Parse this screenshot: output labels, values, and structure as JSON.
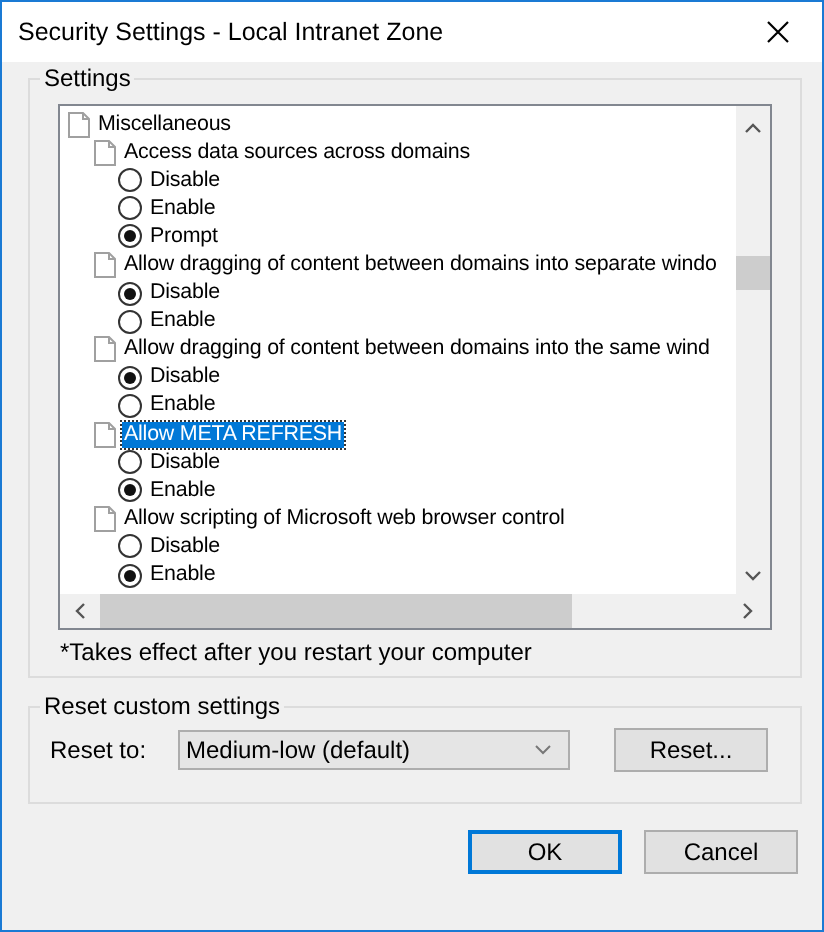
{
  "window": {
    "title": "Security Settings - Local Intranet Zone"
  },
  "settings_group": {
    "label": "Settings",
    "tree": [
      {
        "label": "Miscellaneous",
        "selected": false,
        "children": [
          {
            "label": "Access data sources across domains",
            "selected": false,
            "children": [
              {
                "label": "Disable",
                "selected": false
              },
              {
                "label": "Enable",
                "selected": false
              },
              {
                "label": "Prompt",
                "selected": true
              }
            ]
          },
          {
            "label": "Allow dragging of content between domains into separate windo",
            "selected": false,
            "children": [
              {
                "label": "Disable",
                "selected": true
              },
              {
                "label": "Enable",
                "selected": false
              }
            ]
          },
          {
            "label": "Allow dragging of content between domains into the same wind",
            "selected": false,
            "children": [
              {
                "label": "Disable",
                "selected": true
              },
              {
                "label": "Enable",
                "selected": false
              }
            ]
          },
          {
            "label": "Allow META REFRESH",
            "selected": true,
            "children": [
              {
                "label": "Disable",
                "selected": false
              },
              {
                "label": "Enable",
                "selected": true
              }
            ]
          },
          {
            "label": "Allow scripting of Microsoft web browser control",
            "selected": false,
            "children": [
              {
                "label": "Disable",
                "selected": false
              },
              {
                "label": "Enable",
                "selected": true
              }
            ]
          }
        ]
      }
    ],
    "note": "*Takes effect after you restart your computer"
  },
  "reset_group": {
    "label": "Reset custom settings",
    "reset_to_label": "Reset to:",
    "reset_to_value": "Medium-low (default)",
    "reset_button": "Reset..."
  },
  "buttons": [
    {
      "label": "OK",
      "default": true
    },
    {
      "label": "Cancel",
      "default": false
    }
  ]
}
